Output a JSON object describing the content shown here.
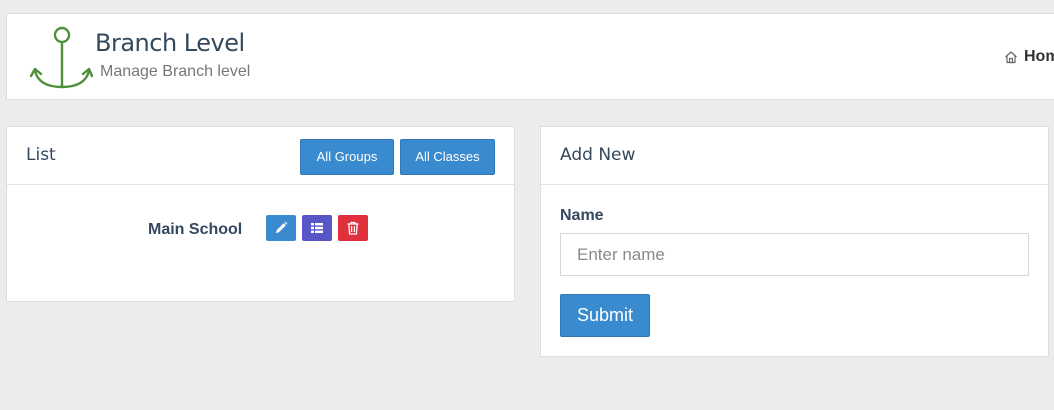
{
  "header": {
    "title": "Branch Level",
    "subtitle": "Manage Branch level",
    "breadcrumb": "Hom",
    "logo_icon": "anchor-icon",
    "logo_color": "#4f8f3a"
  },
  "list_panel": {
    "title": "List",
    "buttons": {
      "all_groups": "All Groups",
      "all_classes": "All Classes"
    },
    "rows": [
      {
        "label": "Main School",
        "actions": [
          "pencil-icon",
          "list-icon",
          "trash-icon"
        ]
      }
    ]
  },
  "add_panel": {
    "title": "Add New",
    "name_label": "Name",
    "name_placeholder": "Enter name",
    "name_value": "",
    "submit_label": "Submit"
  },
  "colors": {
    "primary": "#3a8ad0",
    "indigo": "#5856c4",
    "danger": "#e0303b",
    "heading": "#34495e"
  }
}
